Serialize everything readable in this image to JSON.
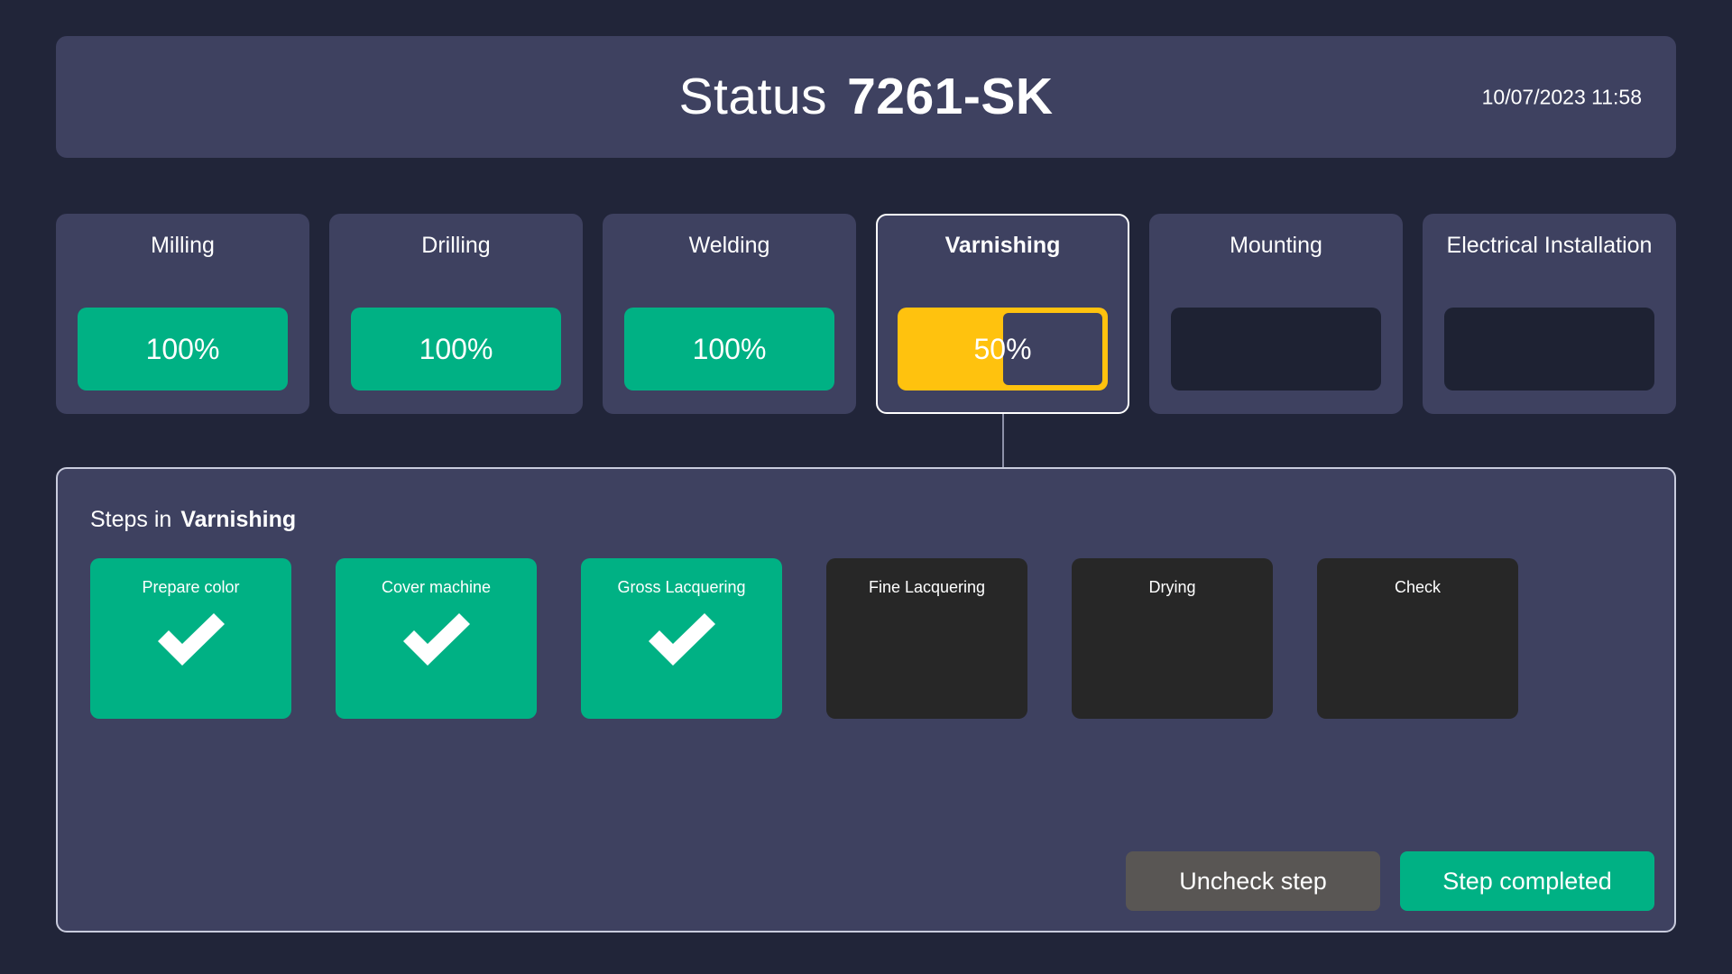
{
  "header": {
    "title_prefix": "Status",
    "order_id": "7261-SK",
    "timestamp": "10/07/2023 11:58"
  },
  "stages": [
    {
      "name": "Milling",
      "progress_label": "100%",
      "progress": 100,
      "state": "complete",
      "active": false
    },
    {
      "name": "Drilling",
      "progress_label": "100%",
      "progress": 100,
      "state": "complete",
      "active": false
    },
    {
      "name": "Welding",
      "progress_label": "100%",
      "progress": 100,
      "state": "complete",
      "active": false
    },
    {
      "name": "Varnishing",
      "progress_label": "50%",
      "progress": 50,
      "state": "in-progress",
      "active": true
    },
    {
      "name": "Mounting",
      "progress_label": "",
      "progress": 0,
      "state": "pending",
      "active": false
    },
    {
      "name": "Electrical Installation",
      "progress_label": "",
      "progress": 0,
      "state": "pending",
      "active": false
    }
  ],
  "steps_panel": {
    "heading_prefix": "Steps in",
    "heading_stage": "Varnishing",
    "steps": [
      {
        "label": "Prepare color",
        "completed": true,
        "check_icon": "check-icon"
      },
      {
        "label": "Cover machine",
        "completed": true,
        "check_icon": "check-icon"
      },
      {
        "label": "Gross Lacquering",
        "completed": true,
        "check_icon": "check-icon"
      },
      {
        "label": "Fine Lacquering",
        "completed": false,
        "check_icon": ""
      },
      {
        "label": "Drying",
        "completed": false,
        "check_icon": ""
      },
      {
        "label": "Check",
        "completed": false,
        "check_icon": ""
      }
    ],
    "uncheck_button": "Uncheck step",
    "complete_button": "Step completed"
  },
  "colors": {
    "page_background": "#212539",
    "panel_background": "#3E4160",
    "complete_green": "#00B184",
    "in_progress_yellow": "#FFC20E",
    "pending_dark": "#1E2233",
    "step_todo_dark": "#272727",
    "secondary_gray": "#595654",
    "border_light": "#C9CCDD",
    "text_white": "#FFFFFF"
  }
}
